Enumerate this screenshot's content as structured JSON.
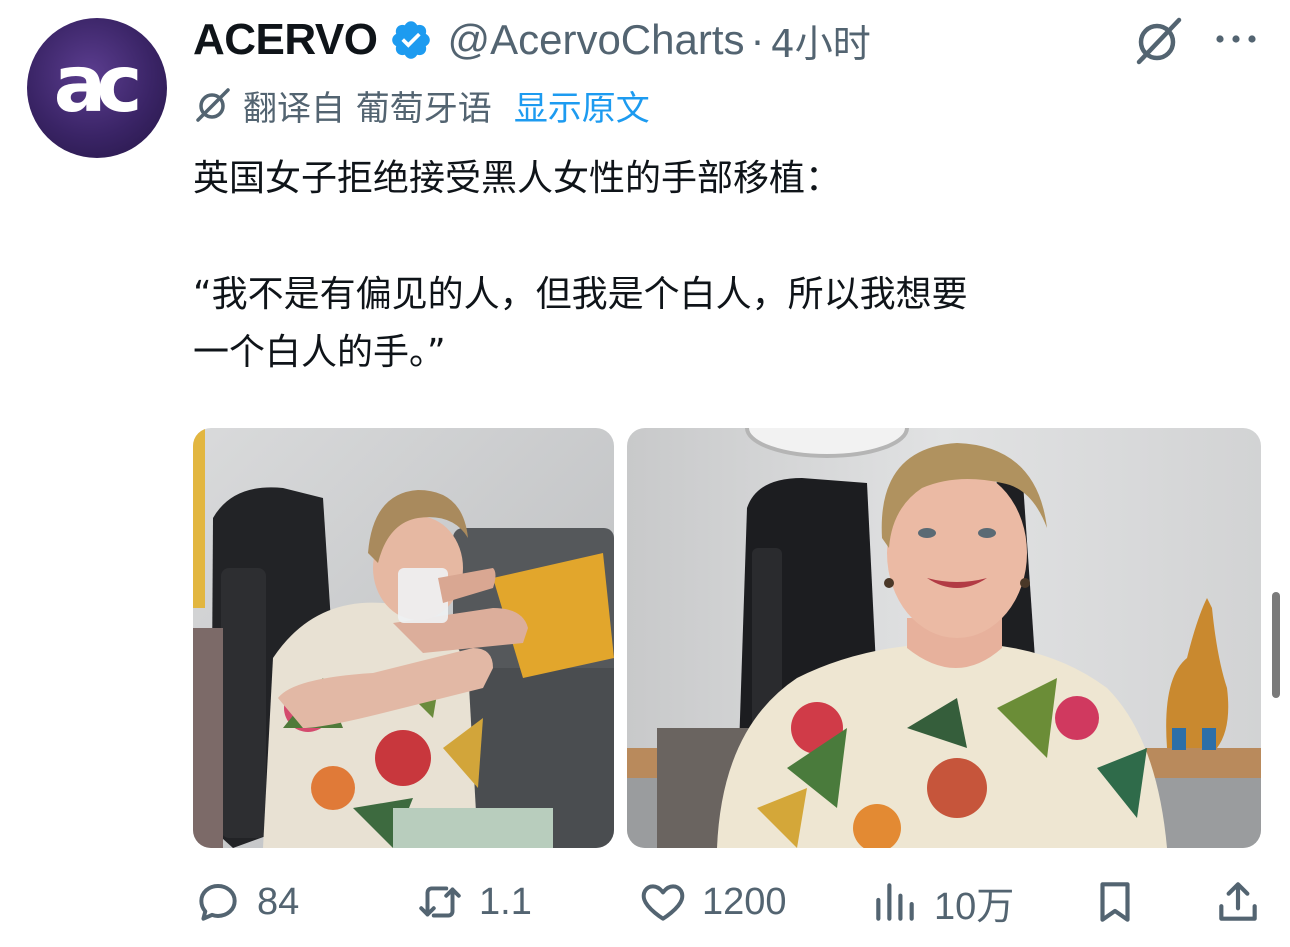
{
  "author": {
    "avatar_text": "ac",
    "display_name": "ACERVO",
    "handle": "@AcervoCharts",
    "separator": "·",
    "time": "4小时"
  },
  "translation": {
    "label": "翻译自 葡萄牙语",
    "show_original": "显示原文"
  },
  "tweet": {
    "lines": [
      "英国女子拒绝接受黑人女性的手部移植：",
      "“我不是有偏见的人，但我是个白人，所以我想要",
      "一个白人的手。”"
    ]
  },
  "media": {
    "count": 2
  },
  "actions": {
    "reply_count": "84",
    "repost_count": "1.1",
    "like_count": "1200",
    "views_count": "10万"
  },
  "colors": {
    "text": "#0f1419",
    "secondary": "#536471",
    "link": "#1d9bf0",
    "verified": "#1d9bf0",
    "avatar": "#3a2466"
  },
  "icons": {
    "verified": "verified-badge-icon",
    "grok": "grok-icon",
    "more": "more-dots-icon",
    "translate": "translate-icon",
    "reply": "reply-icon",
    "repost": "repost-icon",
    "like": "heart-icon",
    "views": "views-bar-chart-icon",
    "bookmark": "bookmark-icon",
    "share": "share-icon"
  }
}
